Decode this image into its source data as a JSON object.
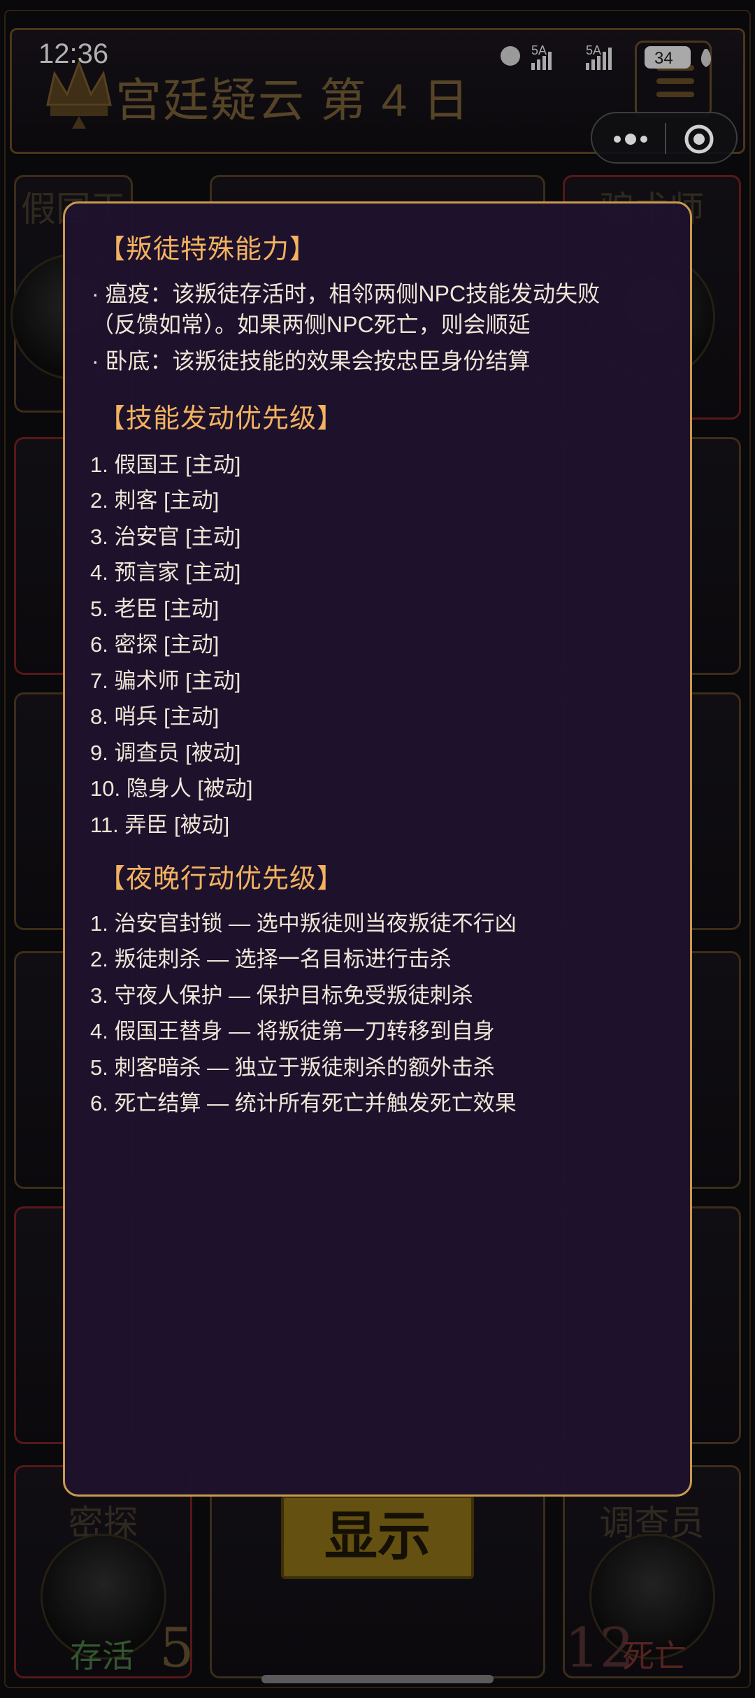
{
  "status_bar": {
    "time": "12:36",
    "network_1": "5A",
    "network_2": "5A",
    "battery": "34"
  },
  "header": {
    "title": "宫廷疑云 第 4 日",
    "crown_icon": "crown-icon",
    "menu_icon": "hamburger-icon"
  },
  "board": {
    "cards": [
      {
        "name": "假国王"
      },
      {
        "name": "骗术师"
      },
      {
        "name": "密探",
        "status": "存活",
        "number": "5"
      },
      {
        "name": "调查员"
      }
    ],
    "bottom_right": {
      "number": "12",
      "status": "死亡"
    },
    "show_button": "显示"
  },
  "modal": {
    "sections": [
      {
        "title": "【叛徒特殊能力】",
        "bullets": [
          {
            "line1": "· 瘟疫：该叛徒存活时，相邻两侧NPC技能发动失败",
            "line2": "（反馈如常）。如果两侧NPC死亡，则会顺延"
          },
          {
            "line1": "· 卧底：该叛徒技能的效果会按忠臣身份结算",
            "line2": ""
          }
        ]
      },
      {
        "title": "【技能发动优先级】",
        "items": [
          "1. 假国王 [主动]",
          "2. 刺客 [主动]",
          "3. 治安官 [主动]",
          "4. 预言家 [主动]",
          "5. 老臣 [主动]",
          "6. 密探 [主动]",
          "7. 骗术师 [主动]",
          "8. 哨兵 [主动]",
          "9. 调查员 [被动]",
          "10. 隐身人 [被动]",
          "11. 弄臣 [被动]"
        ]
      },
      {
        "title": "【夜晚行动优先级】",
        "items": [
          "1. 治安官封锁 — 选中叛徒则当夜叛徒不行凶",
          "2. 叛徒刺杀 — 选择一名目标进行击杀",
          "3. 守夜人保护 — 保护目标免受叛徒刺杀",
          "4. 假国王替身 — 将叛徒第一刀转移到自身",
          "5. 刺客暗杀 — 独立于叛徒刺杀的额外击杀",
          "6. 死亡结算 — 统计所有死亡并触发死亡效果"
        ]
      }
    ]
  },
  "colors": {
    "modal_bg": "#1e122e",
    "modal_border": "#c99a4b",
    "section_title": "#f3b25f",
    "body_text": "#efe6d6",
    "alive_green": "#3f6a3a",
    "dead_red": "#6a2a2a"
  }
}
